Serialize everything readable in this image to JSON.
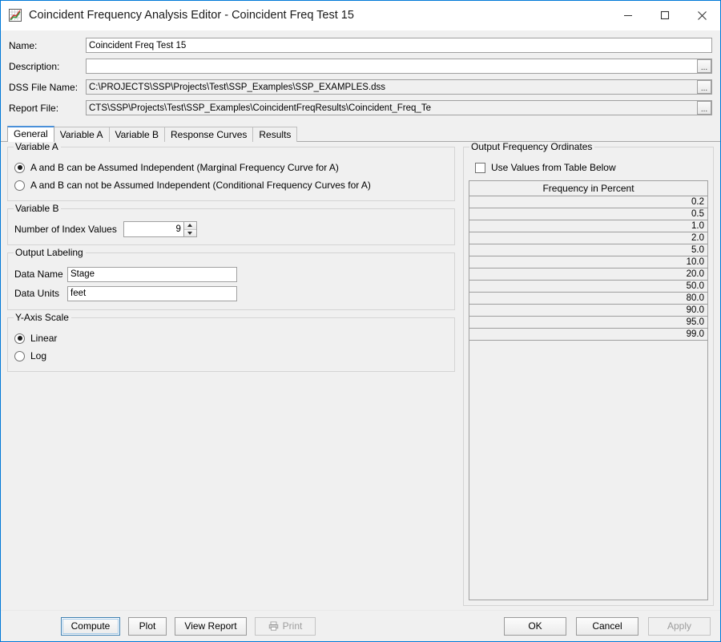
{
  "window": {
    "title": "Coincident Frequency Analysis Editor - Coincident Freq Test 15",
    "icon": "chart-graph-icon",
    "minimize_label": "Minimize",
    "maximize_label": "Maximize",
    "close_label": "Close",
    "border_color": "#0078d7"
  },
  "form": {
    "name_label": "Name:",
    "name_value": "Coincident Freq Test 15",
    "description_label": "Description:",
    "description_value": "",
    "description_placeholder": "",
    "dss_label": "DSS File Name:",
    "dss_value": "C:\\PROJECTS\\SSP\\Projects\\Test\\SSP_Examples\\SSP_EXAMPLES.dss",
    "report_label": "Report File:",
    "report_value": "CTS\\SSP\\Projects\\Test\\SSP_Examples\\CoincidentFreqResults\\Coincident_Freq_Te",
    "browse_label": "..."
  },
  "tabs": [
    {
      "label": "General",
      "active": true
    },
    {
      "label": "Variable A",
      "active": false
    },
    {
      "label": "Variable B",
      "active": false
    },
    {
      "label": "Response Curves",
      "active": false
    },
    {
      "label": "Results",
      "active": false
    }
  ],
  "variable_a": {
    "legend": "Variable A",
    "options": [
      {
        "label": "A and B can be Assumed Independent (Marginal Frequency Curve for A)",
        "selected": true
      },
      {
        "label": "A and B can not be Assumed Independent (Conditional Frequency Curves for A)",
        "selected": false
      }
    ]
  },
  "variable_b": {
    "legend": "Variable B",
    "index_label": "Number of Index Values",
    "index_value": "9"
  },
  "output_labeling": {
    "legend": "Output Labeling",
    "data_name_label": "Data Name",
    "data_name_value": "Stage",
    "data_units_label": "Data Units",
    "data_units_value": "feet"
  },
  "y_axis_scale": {
    "legend": "Y-Axis Scale",
    "options": [
      {
        "label": "Linear",
        "selected": true
      },
      {
        "label": "Log",
        "selected": false
      }
    ]
  },
  "output_frequency_ordinates": {
    "legend": "Output Frequency Ordinates",
    "use_values_label": "Use Values from Table Below",
    "use_values_checked": false,
    "table": {
      "column_header": "Frequency in Percent",
      "rows": [
        "0.2",
        "0.5",
        "1.0",
        "2.0",
        "5.0",
        "10.0",
        "20.0",
        "50.0",
        "80.0",
        "90.0",
        "95.0",
        "99.0"
      ]
    }
  },
  "buttons": {
    "compute": "Compute",
    "plot": "Plot",
    "view_report": "View Report",
    "print": "Print",
    "ok": "OK",
    "cancel": "Cancel",
    "apply": "Apply"
  }
}
